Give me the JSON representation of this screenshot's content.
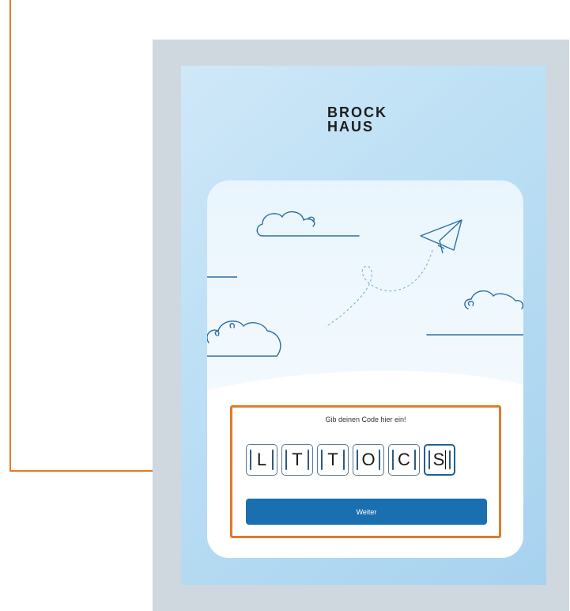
{
  "app": {
    "logo_line1": "BROCK",
    "logo_line2": "HAUS"
  },
  "form": {
    "prompt": "Gib deinen Code hier ein!",
    "code_chars": [
      "L",
      "T",
      "T",
      "O",
      "C",
      "S"
    ],
    "active_index": 5,
    "submit_label": "Weiter"
  },
  "colors": {
    "callout": "#e07c28",
    "button": "#1a6fb0",
    "frame": "#cfd7df",
    "screen": "#bcdff4"
  },
  "icons": [
    "cloud-icon",
    "paper-plane-icon"
  ]
}
